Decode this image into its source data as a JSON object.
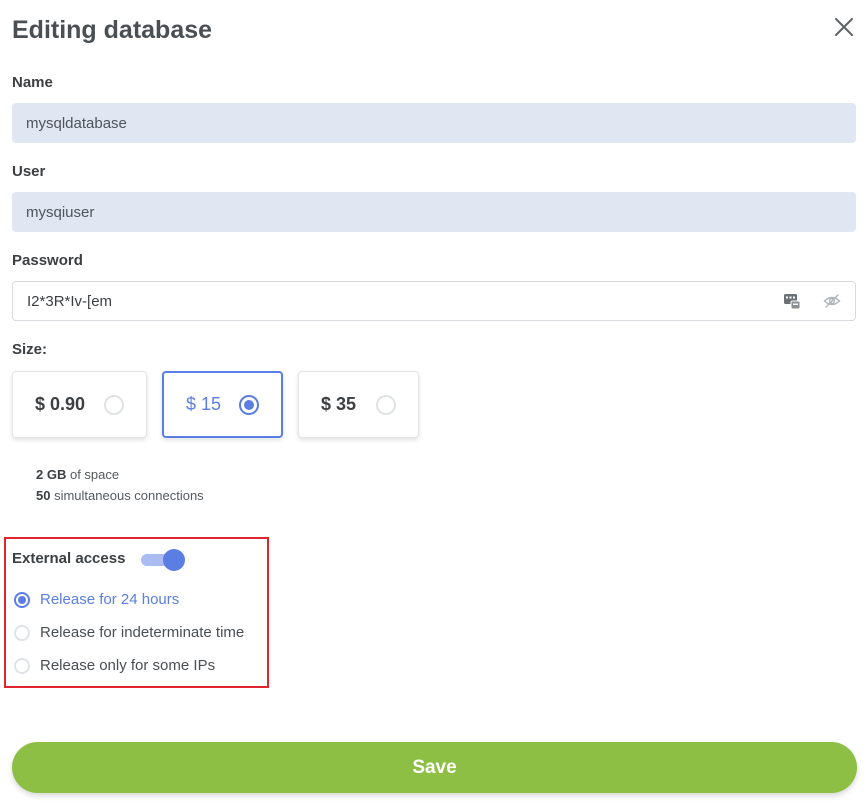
{
  "dialog": {
    "title": "Editing database",
    "close_icon": "close-icon"
  },
  "fields": {
    "name": {
      "label": "Name",
      "value": "mysqldatabase"
    },
    "user": {
      "label": "User",
      "value": "mysqiuser"
    },
    "password": {
      "label": "Password",
      "value": "I2*3R*Iv-[em",
      "icons": [
        "generate-password-icon",
        "hide-password-icon"
      ]
    }
  },
  "size": {
    "label": "Size:",
    "options": [
      {
        "price": "$ 0.90",
        "selected": false
      },
      {
        "price": "$ 15",
        "selected": true
      },
      {
        "price": "$ 35",
        "selected": false
      }
    ],
    "specs": {
      "space_value": "2 GB",
      "space_text": "of space",
      "connections_value": "50",
      "connections_text": "simultaneous connections"
    }
  },
  "external_access": {
    "label": "External access",
    "enabled": true,
    "options": [
      {
        "label": "Release for 24 hours",
        "selected": true
      },
      {
        "label": "Release for indeterminate time",
        "selected": false
      },
      {
        "label": "Release only for some IPs",
        "selected": false
      }
    ]
  },
  "save_label": "Save",
  "colors": {
    "accent": "#5b7ee5",
    "save_green": "#8dbf45",
    "readonly_bg": "#e1e6f3",
    "highlight_red": "#e0252f"
  }
}
